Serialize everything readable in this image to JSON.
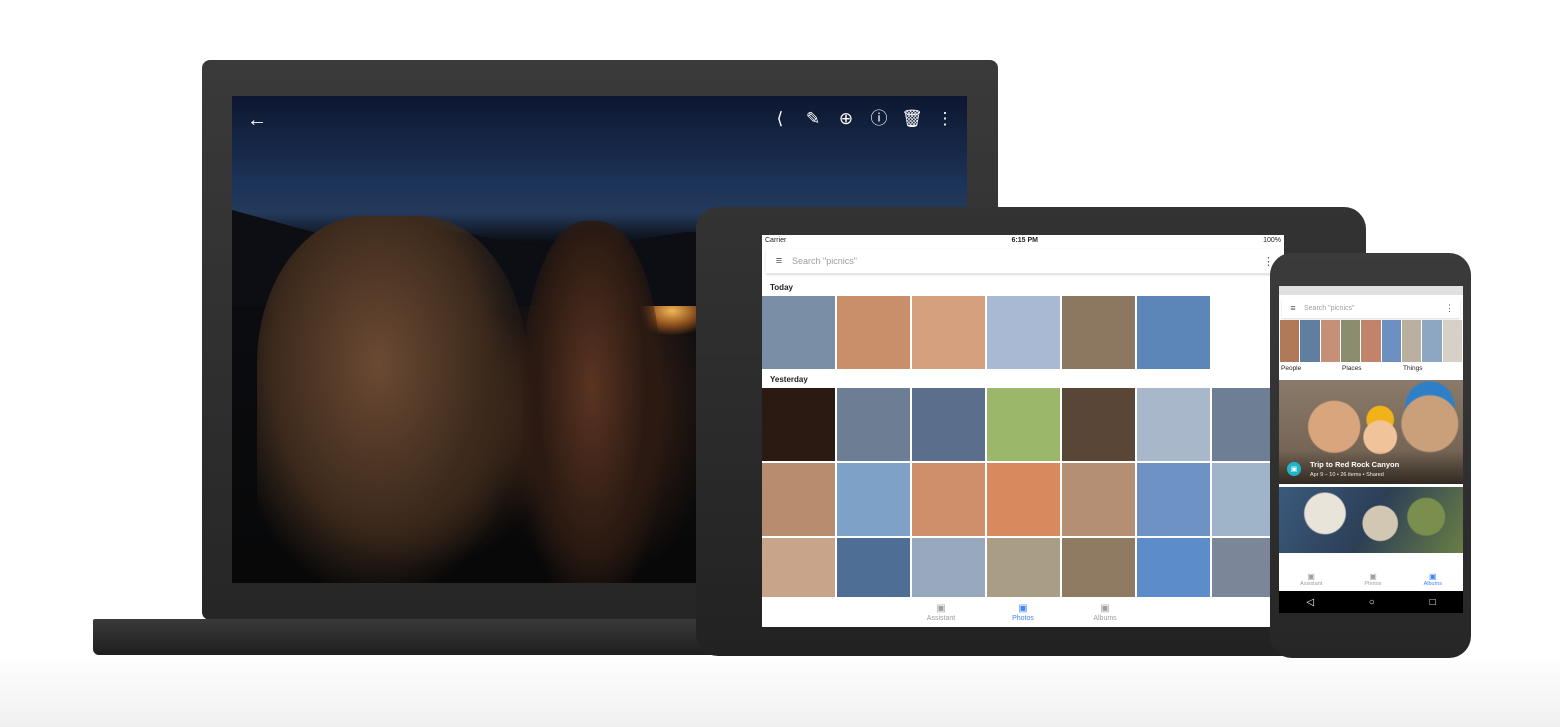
{
  "laptop": {
    "toolbar": {
      "back": "←",
      "share": "⟨",
      "edit": "✎",
      "zoom": "⊕",
      "info": "ⓘ",
      "delete": "🗑",
      "more": "⋮"
    }
  },
  "tablet": {
    "status": {
      "carrier": "Carrier",
      "time": "6:15 PM",
      "battery": "100%"
    },
    "search": {
      "menu": "≡",
      "placeholder": "Search \"picnics\"",
      "more": "⋮"
    },
    "sections": [
      {
        "label": "Today",
        "colors": [
          "#7a8fa6",
          "#c98f6b",
          "#d4a07e",
          "#a9b9d4",
          "#8c7760",
          "#5c86b8"
        ]
      },
      {
        "label": "Yesterday",
        "rows": [
          [
            "#2a1a12",
            "#6d7d94",
            "#5b6f8c",
            "#9bb86a",
            "#5a4636",
            "#a8b7c9",
            "#6e7f95"
          ],
          [
            "#b88c6f",
            "#7ea1c8",
            "#cf8f6a",
            "#d88a5e",
            "#b48f74",
            "#6e92c4",
            "#9fb3c9"
          ],
          [
            "#c8a48a",
            "#4f6e96",
            "#98a8bd",
            "#aa9d86",
            "#8f7a62",
            "#5c8cc9",
            "#7b8799"
          ]
        ]
      }
    ],
    "tabs": [
      {
        "icon": "▣",
        "label": "Assistant"
      },
      {
        "icon": "▣",
        "label": "Photos"
      },
      {
        "icon": "▣",
        "label": "Albums"
      }
    ]
  },
  "phone": {
    "search": {
      "menu": "≡",
      "placeholder": "Search \"picnics\"",
      "more": "⋮"
    },
    "categories": [
      {
        "label": "People",
        "colors": [
          "#b07a58",
          "#5f7ea0",
          "#c59076"
        ]
      },
      {
        "label": "Places",
        "colors": [
          "#8c8c6f",
          "#c1846b",
          "#6e8fc1"
        ]
      },
      {
        "label": "Things",
        "colors": [
          "#b9b0a0",
          "#8da6c2",
          "#d6d0c6"
        ]
      }
    ],
    "album": {
      "badge": "▣",
      "title": "Trip to Red Rock Canyon",
      "meta": "Apr 9 – 10  •  26 items  •  Shared"
    },
    "tabs": [
      {
        "icon": "▣",
        "label": "Assistant"
      },
      {
        "icon": "▣",
        "label": "Photos"
      },
      {
        "icon": "▣",
        "label": "Albums"
      }
    ],
    "nav": {
      "back": "◁",
      "home": "○",
      "recents": "□"
    }
  },
  "colors": {
    "accent": "#4285f4",
    "badge": "#1eb7c9",
    "bezel": "#2b2b2b"
  }
}
